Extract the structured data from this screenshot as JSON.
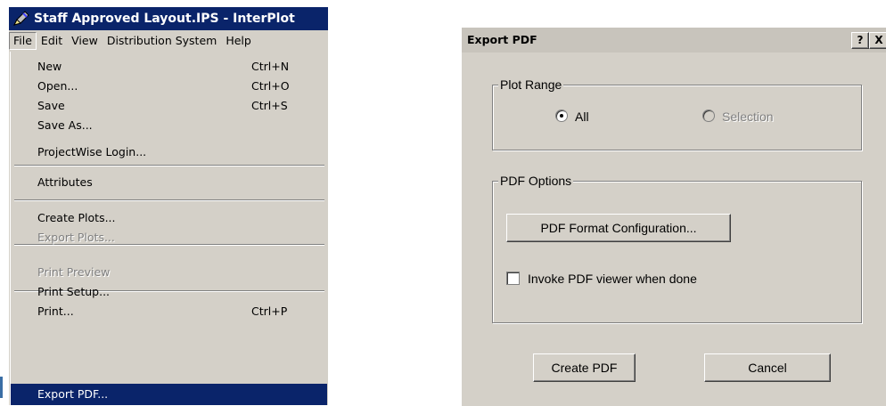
{
  "app": {
    "title": "Staff Approved Layout.IPS - InterPlot",
    "icon": "pen-app-icon",
    "menubar": [
      "File",
      "Edit",
      "View",
      "Distribution System",
      "Help"
    ],
    "file_menu": [
      {
        "label": "New",
        "accel": "Ctrl+N",
        "state": "enabled"
      },
      {
        "label": "Open...",
        "accel": "Ctrl+O",
        "state": "enabled"
      },
      {
        "label": "Save",
        "accel": "Ctrl+S",
        "state": "enabled"
      },
      {
        "label": "Save As...",
        "accel": "",
        "state": "enabled"
      },
      {
        "label": "ProjectWise Login...",
        "accel": "",
        "state": "enabled"
      },
      {
        "label": "Attributes",
        "accel": "",
        "state": "enabled"
      },
      {
        "label": "Create Plots...",
        "accel": "",
        "state": "enabled"
      },
      {
        "label": "Export Plots...",
        "accel": "",
        "state": "disabled"
      },
      {
        "label": "Print Preview",
        "accel": "",
        "state": "disabled"
      },
      {
        "label": "Print Setup...",
        "accel": "",
        "state": "enabled"
      },
      {
        "label": "Print...",
        "accel": "Ctrl+P",
        "state": "enabled"
      },
      {
        "label": "Export PDF...",
        "accel": "",
        "state": "highlighted"
      }
    ]
  },
  "dialog": {
    "title": "Export PDF",
    "help_button": "?",
    "close_button": "X",
    "plot_range": {
      "label": "Plot Range",
      "all_label": "All",
      "all_selected": true,
      "selection_label": "Selection",
      "selection_enabled": false
    },
    "pdf_options": {
      "label": "PDF Options",
      "config_button": "PDF Format Configuration...",
      "invoke_viewer_label": "Invoke PDF viewer when done",
      "invoke_viewer_checked": false
    },
    "create_button": "Create PDF",
    "cancel_button": "Cancel"
  },
  "colors": {
    "titlebar": "#0a246a",
    "menu_highlight": "#0a246a",
    "face": "#d4d0c8"
  }
}
